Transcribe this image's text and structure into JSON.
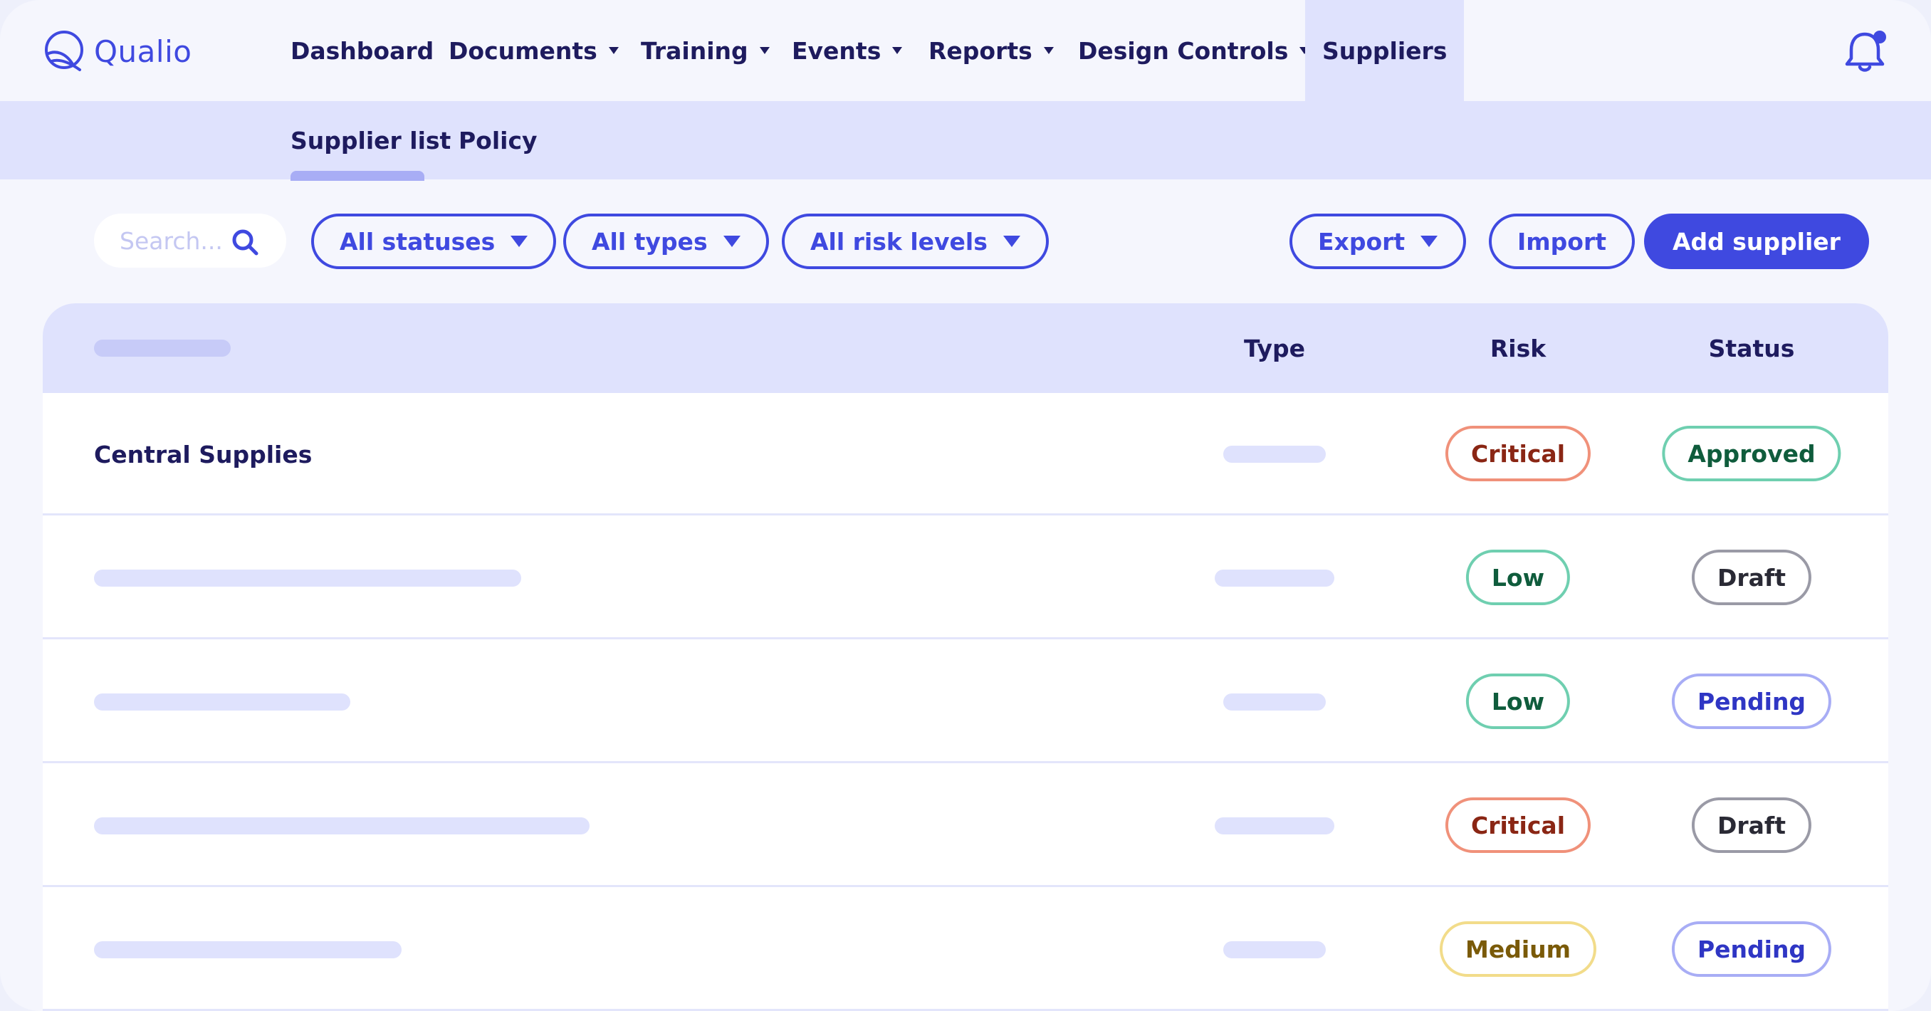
{
  "app": {
    "logo_text": "Qualio"
  },
  "nav": {
    "items": [
      {
        "label": "Dashboard",
        "has_caret": false
      },
      {
        "label": "Documents",
        "has_caret": true
      },
      {
        "label": "Training",
        "has_caret": true
      },
      {
        "label": "Events",
        "has_caret": true
      },
      {
        "label": "Reports",
        "has_caret": true
      },
      {
        "label": "Design Controls",
        "has_caret": true
      },
      {
        "label": "Suppliers",
        "has_caret": false,
        "active": true
      }
    ]
  },
  "subnav": {
    "items": [
      {
        "label": "Supplier list",
        "active": true
      },
      {
        "label": "Policy"
      }
    ]
  },
  "toolbar": {
    "search_placeholder": "Search...",
    "filter_status": "All statuses",
    "filter_type": "All types",
    "filter_risk": "All risk levels",
    "export_label": "Export",
    "import_label": "Import",
    "add_label": "Add supplier"
  },
  "table": {
    "columns": {
      "type": "Type",
      "risk": "Risk",
      "status": "Status"
    },
    "rows": [
      {
        "name": "Central Supplies",
        "risk": "Critical",
        "status": "Approved"
      },
      {
        "name": "",
        "risk": "Low",
        "status": "Draft"
      },
      {
        "name": "",
        "risk": "Low",
        "status": "Pending"
      },
      {
        "name": "",
        "risk": "Critical",
        "status": "Draft"
      },
      {
        "name": "",
        "risk": "Medium",
        "status": "Pending"
      }
    ]
  },
  "colors": {
    "accent": "#3f49e0",
    "critical_border": "#f0917a",
    "critical_text": "#8a2614",
    "low_border": "#6fcfb0",
    "low_text": "#0f5c3c",
    "medium_border": "#f2dc8a",
    "medium_text": "#7a5a08",
    "approved_border": "#6fcfb0",
    "approved_text": "#0f5c3c",
    "draft_border": "#9a9aa6",
    "draft_text": "#2a2a35",
    "pending_border": "#a8adf5",
    "pending_text": "#2f36c4"
  }
}
